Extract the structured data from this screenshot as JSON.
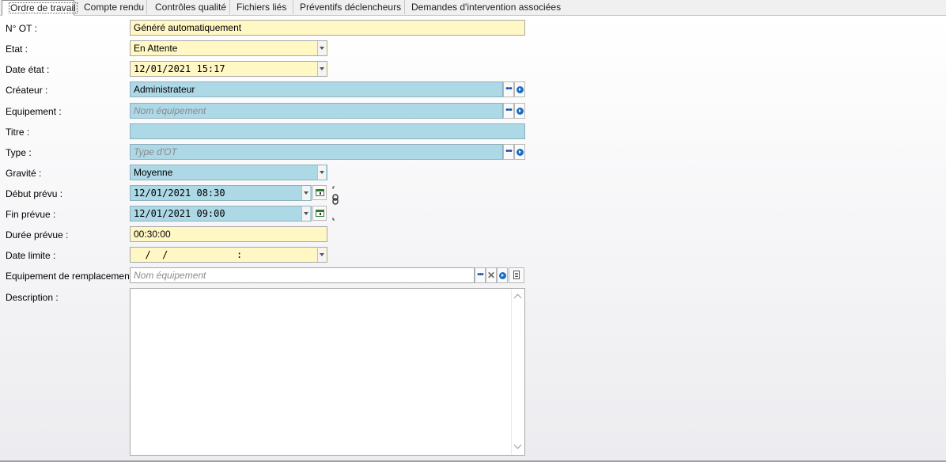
{
  "tabs": [
    {
      "label": "Ordre de travail",
      "active": true
    },
    {
      "label": "Compte rendu"
    },
    {
      "label": "Contrôles qualité"
    },
    {
      "label": "Fichiers liés"
    },
    {
      "label": "Préventifs déclencheurs"
    },
    {
      "label": "Demandes d'intervention associées"
    }
  ],
  "form": {
    "num_ot": {
      "label": "N° OT :",
      "value": "Généré automatiquement"
    },
    "etat": {
      "label": "Etat :",
      "value": "En Attente"
    },
    "date_etat": {
      "label": "Date état :",
      "value": "12/01/2021 15:17"
    },
    "createur": {
      "label": "Créateur :",
      "value": "Administrateur"
    },
    "equipement": {
      "label": "Equipement :",
      "placeholder": "Nom équipement"
    },
    "titre": {
      "label": "Titre :",
      "value": ""
    },
    "type": {
      "label": "Type :",
      "placeholder": "Type d'OT"
    },
    "gravite": {
      "label": "Gravité :",
      "value": "Moyenne"
    },
    "debut_prevu": {
      "label": "Début prévu :",
      "value": "12/01/2021 08:30"
    },
    "fin_prevue": {
      "label": "Fin prévue :",
      "value": "12/01/2021 09:00"
    },
    "duree_prevue": {
      "label": "Durée prévue :",
      "value": "00:30:00"
    },
    "date_limite": {
      "label": "Date limite :",
      "value": "  /  /            :"
    },
    "equipement_remplacement": {
      "label": "Equipement de remplacement :",
      "placeholder": "Nom équipement"
    },
    "description": {
      "label": "Description :",
      "value": ""
    }
  },
  "colors": {
    "required": "#fff7c4",
    "lookup": "#add8e6",
    "icon_blue": "#1b6fc2",
    "calendar_green": "#2e7d32"
  },
  "icons": [
    "ellipsis-icon",
    "go-icon",
    "calendar-icon",
    "link-chain-icon",
    "clear-icon",
    "document-icon"
  ]
}
